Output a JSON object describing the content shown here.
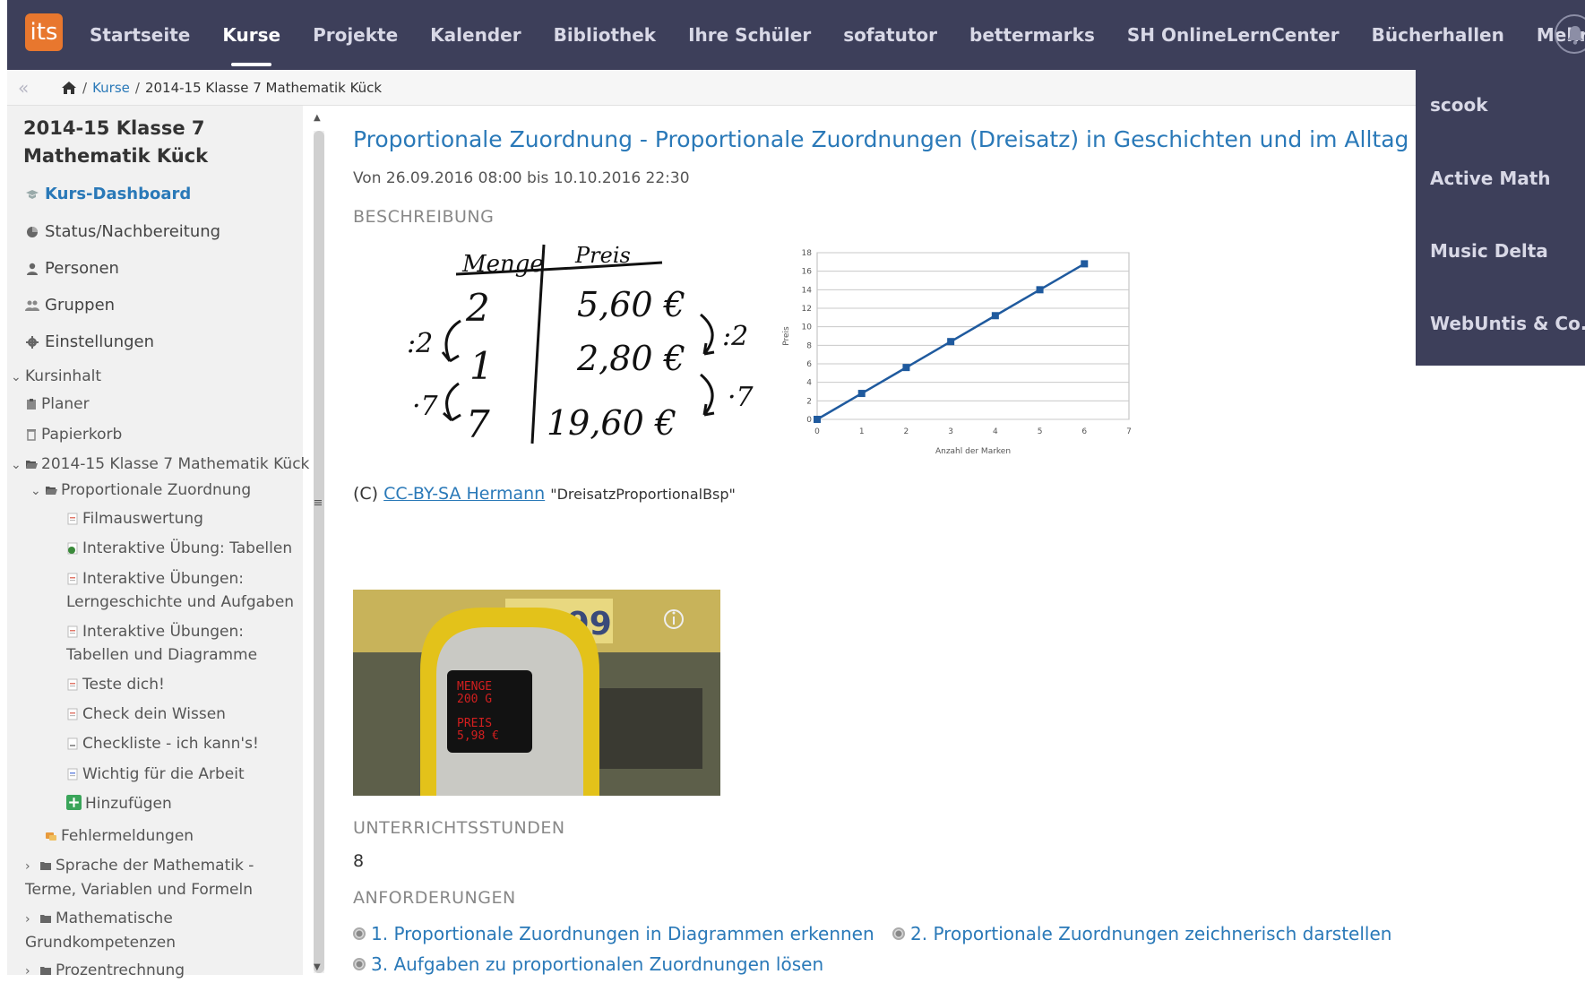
{
  "logo": {
    "text": "its"
  },
  "nav": {
    "items": [
      {
        "label": "Startseite"
      },
      {
        "label": "Kurse"
      },
      {
        "label": "Projekte"
      },
      {
        "label": "Kalender"
      },
      {
        "label": "Bibliothek"
      },
      {
        "label": "Ihre Schüler"
      },
      {
        "label": "sofatutor"
      },
      {
        "label": "bettermarks"
      },
      {
        "label": "SH OnlineLernCenter"
      },
      {
        "label": "Bücherhallen"
      },
      {
        "label": "Mehr"
      }
    ],
    "active_index": 1
  },
  "more_menu": {
    "items": [
      {
        "label": "scook"
      },
      {
        "label": "Active Math"
      },
      {
        "label": "Music Delta"
      },
      {
        "label": "WebUntis & Co."
      }
    ]
  },
  "breadcrumb": {
    "courses": "Kurse",
    "separator": "/",
    "current": "2014-15 Klasse 7 Mathematik Kück"
  },
  "sidebar": {
    "course_title": "2014-15 Klasse 7 Mathematik Kück",
    "menu": [
      {
        "label": "Kurs-Dashboard"
      },
      {
        "label": "Status/Nachbereitung"
      },
      {
        "label": "Personen"
      },
      {
        "label": "Gruppen"
      },
      {
        "label": "Einstellungen"
      }
    ],
    "content_heading": "Kursinhalt",
    "tree": {
      "planner": "Planer",
      "trash": "Papierkorb",
      "course_folder": "2014-15 Klasse 7 Mathematik Kück",
      "topic": "Proportionale Zuordnung",
      "topic_items": [
        {
          "label": "Filmauswertung"
        },
        {
          "label": "Interaktive Übung: Tabellen"
        },
        {
          "label": "Interaktive Übungen: Lerngeschichte und Aufgaben"
        },
        {
          "label": "Interaktive Übungen: Tabellen und Diagramme"
        },
        {
          "label": "Teste dich!"
        },
        {
          "label": "Check dein Wissen"
        },
        {
          "label": "Checkliste - ich kann's!"
        },
        {
          "label": "Wichtig für die Arbeit"
        }
      ],
      "add": "Hinzufügen",
      "errors": "Fehlermeldungen",
      "folders": [
        {
          "label": "Sprache der Mathematik - Terme, Variablen und Formeln"
        },
        {
          "label": "Mathematische Grundkompetenzen"
        },
        {
          "label": "Prozentrechnung"
        }
      ]
    }
  },
  "main": {
    "title": "Proportionale Zuordnung - Proportionale Zuordnungen (Dreisatz) in Geschichten und im Alltag",
    "dates": "Von 26.09.2016 08:00 bis 10.10.2016 22:30",
    "description_heading": "BESCHREIBUNG",
    "sketch": {
      "col1": "Menge",
      "col2": "Preis",
      "rows": [
        {
          "qty": "2",
          "price": "5,60 €"
        },
        {
          "qty": "1",
          "price": "2,80 €"
        },
        {
          "qty": "7",
          "price": "19,60 €"
        }
      ],
      "op1": ":2",
      "op2": "·7"
    },
    "credit": {
      "prefix": "(C)",
      "link": "CC-BY-SA Hermann",
      "name": "\"DreisatzProportionalBsp\""
    },
    "video": {
      "display_line1": "MENGE",
      "display_line2": "200 G",
      "display_line3": "PREIS",
      "display_line4": "5,98 €",
      "sign": "2,99"
    },
    "lessons_heading": "UNTERRICHTSSTUNDEN",
    "lessons_value": "8",
    "requirements_heading": "ANFORDERUNGEN",
    "requirements": [
      {
        "label": "1. Proportionale Zuordnungen in Diagrammen erkennen"
      },
      {
        "label": "2. Proportionale Zuordnungen zeichnerisch darstellen"
      },
      {
        "label": "3. Aufgaben zu proportionalen Zuordnungen lösen"
      }
    ]
  },
  "chart_data": {
    "type": "line",
    "x": [
      0,
      1,
      2,
      3,
      4,
      5,
      6
    ],
    "series": [
      {
        "values": [
          0,
          2.8,
          5.6,
          8.4,
          11.2,
          14,
          16.8
        ]
      }
    ],
    "xlabel": "Anzahl der Marken",
    "ylabel": "Preis",
    "xlim": [
      0,
      7
    ],
    "ylim": [
      0,
      18
    ],
    "x_ticks": [
      0,
      1,
      2,
      3,
      4,
      5,
      6,
      7
    ],
    "y_ticks": [
      0,
      2,
      4,
      6,
      8,
      10,
      12,
      14,
      16,
      18
    ],
    "grid": true,
    "color": "#1f5a9e"
  }
}
